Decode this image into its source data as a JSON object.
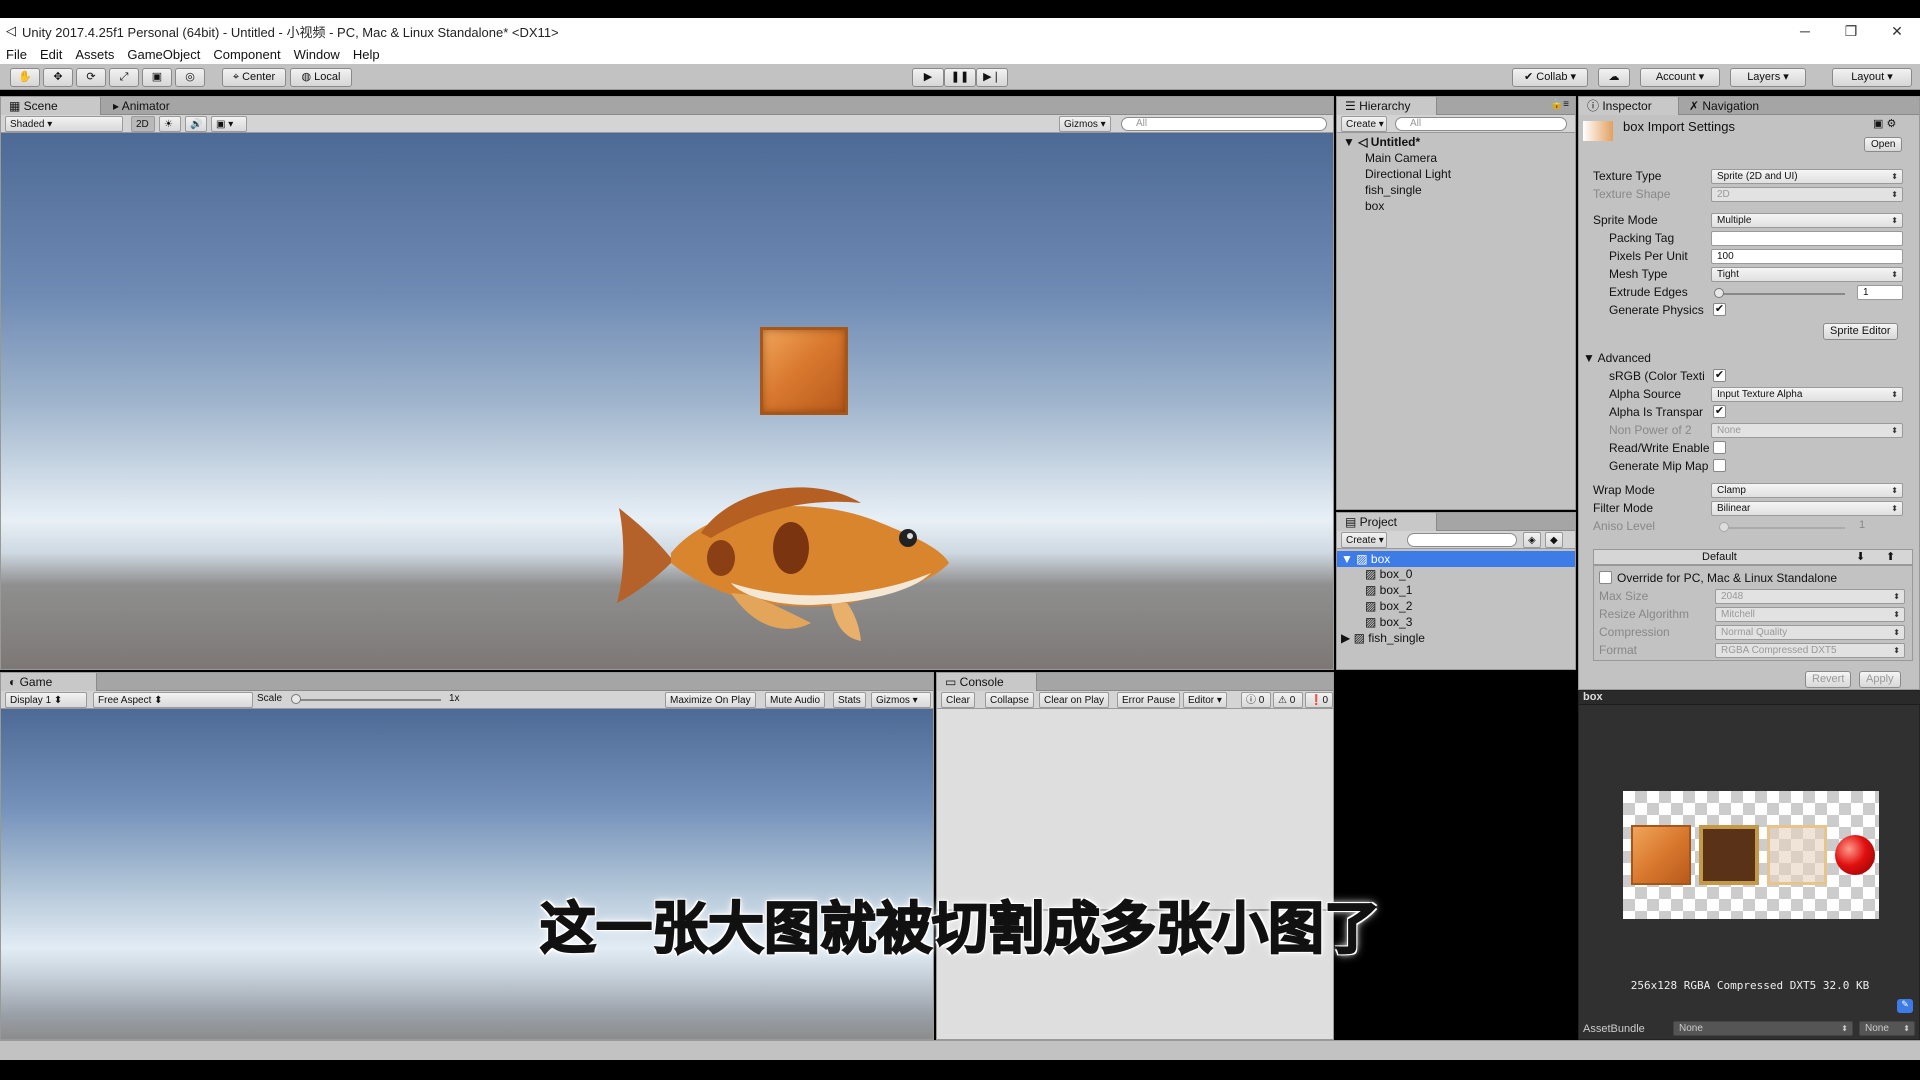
{
  "window": {
    "title": "Unity 2017.4.25f1 Personal (64bit) - Untitled - 小视频 - PC, Mac & Linux Standalone* <DX11>"
  },
  "menu": [
    "File",
    "Edit",
    "Assets",
    "GameObject",
    "Component",
    "Window",
    "Help"
  ],
  "toolbar": {
    "center": "Center",
    "local": "Local",
    "collab": "Collab",
    "account": "Account",
    "layers": "Layers",
    "layout": "Layout"
  },
  "scene": {
    "tab": "Scene",
    "tab2": "Animator",
    "shading": "Shaded",
    "mode2d": "2D",
    "gizmos": "Gizmos",
    "search": "All"
  },
  "hierarchy": {
    "tab": "Hierarchy",
    "create": "Create",
    "search": "All",
    "scene_name": "Untitled*",
    "items": [
      "Main Camera",
      "Directional Light",
      "fish_single",
      "box"
    ]
  },
  "project": {
    "tab": "Project",
    "create": "Create",
    "selected": "box",
    "children": [
      "box_0",
      "box_1",
      "box_2",
      "box_3"
    ],
    "other": "fish_single"
  },
  "inspector": {
    "tab": "Inspector",
    "tab2": "Navigation",
    "header": "box Import Settings",
    "open": "Open",
    "texture_type_label": "Texture Type",
    "texture_type": "Sprite (2D and UI)",
    "texture_shape_label": "Texture Shape",
    "texture_shape": "2D",
    "sprite_mode_label": "Sprite Mode",
    "sprite_mode": "Multiple",
    "packing_tag_label": "Packing Tag",
    "packing_tag": "",
    "ppu_label": "Pixels Per Unit",
    "ppu": "100",
    "mesh_type_label": "Mesh Type",
    "mesh_type": "Tight",
    "extrude_label": "Extrude Edges",
    "extrude": "1",
    "gen_physics_label": "Generate Physics",
    "gen_physics": true,
    "sprite_editor": "Sprite Editor",
    "advanced": "Advanced",
    "srgb_label": "sRGB (Color Texti",
    "srgb": true,
    "alpha_source_label": "Alpha Source",
    "alpha_source": "Input Texture Alpha",
    "alpha_transp_label": "Alpha Is Transpar",
    "alpha_transp": true,
    "npot_label": "Non Power of 2",
    "npot": "None",
    "readwrite_label": "Read/Write Enable",
    "readwrite": false,
    "mipmap_label": "Generate Mip Map",
    "mipmap": false,
    "wrap_label": "Wrap Mode",
    "wrap": "Clamp",
    "filter_label": "Filter Mode",
    "filter": "Bilinear",
    "aniso_label": "Aniso Level",
    "aniso": "1",
    "platform_default": "Default",
    "override_label": "Override for PC, Mac & Linux Standalone",
    "max_size_label": "Max Size",
    "max_size": "2048",
    "resize_label": "Resize Algorithm",
    "resize": "Mitchell",
    "compression_label": "Compression",
    "compression": "Normal Quality",
    "format_label": "Format",
    "format": "RGBA Compressed DXT5",
    "revert": "Revert",
    "apply": "Apply"
  },
  "preview": {
    "title": "box",
    "info": "256x128  RGBA Compressed DXT5   32.0 KB",
    "assetbundle_label": "AssetBundle",
    "assetbundle": "None",
    "variant": "None"
  },
  "game": {
    "tab": "Game",
    "display": "Display 1",
    "aspect": "Free Aspect",
    "scale_label": "Scale",
    "scale": "1x",
    "maximize": "Maximize On Play",
    "mute": "Mute Audio",
    "stats": "Stats",
    "gizmos": "Gizmos"
  },
  "console": {
    "tab": "Console",
    "clear": "Clear",
    "collapse": "Collapse",
    "clear_on_play": "Clear on Play",
    "error_pause": "Error Pause",
    "editor": "Editor",
    "count_info": "0",
    "count_warn": "0",
    "count_err": "0"
  },
  "subtitle": "这一张大图就被切割成多张小图了",
  "colors": {
    "selection": "#3d7be6",
    "panel": "#c2c2c2",
    "box_orange": "#d9792f"
  }
}
